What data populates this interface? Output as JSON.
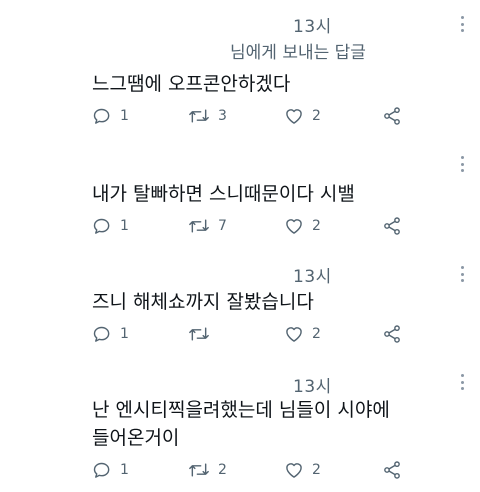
{
  "tweets": [
    {
      "time": "13시",
      "reply_to": "님에게 보내는 답글",
      "text_lines": [
        "느그땜에 오프콘안하겠다"
      ],
      "replies": "1",
      "retweets": "3",
      "likes": "2"
    },
    {
      "text_lines": [
        "내가 탈빠하면 스니때문이다 시밸"
      ],
      "replies": "1",
      "retweets": "7",
      "likes": "2"
    },
    {
      "time": "13시",
      "text_lines": [
        "즈니 해체쇼까지 잘봤습니다"
      ],
      "replies": "1",
      "retweets": "",
      "likes": "2"
    },
    {
      "time": "13시",
      "text_lines": [
        "난 엔시티찍을려했는데 님들이 시야에",
        "들어온거이"
      ],
      "replies": "1",
      "retweets": "2",
      "likes": "2"
    }
  ],
  "icons": [
    "reply-icon",
    "retweet-icon",
    "like-icon",
    "share-icon",
    "more-icon"
  ],
  "colors": {
    "text": "#0f1419",
    "secondary": "#536471"
  }
}
